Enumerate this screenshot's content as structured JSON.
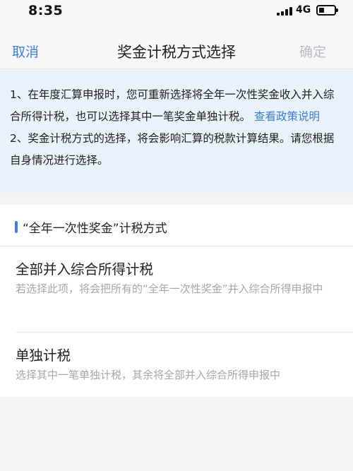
{
  "status_bar": {
    "time": "8:35",
    "network": "4G",
    "icons": [
      "signal-bars-icon",
      "battery-icon"
    ]
  },
  "nav": {
    "cancel_label": "取消",
    "title": "奖金计税方式选择",
    "confirm_label": "确定"
  },
  "notice": {
    "line1_text": "1、在年度汇算申报时，您可重新选择将全年一次性奖金收入并入综合所得计税，也可以选择其中一笔奖金单独计税。",
    "line1_link": "查看政策说明",
    "line2_text": "2、奖金计税方式的选择，将会影响汇算的税款计算结果。请您根据自身情况进行选择。"
  },
  "section": {
    "title": "“全年一次性奖金”计税方式",
    "options": [
      {
        "title": "全部并入综合所得计税",
        "description": "若选择此项，将会把所有的“全年一次性奖金”并入综合所得申报中"
      },
      {
        "title": "单独计税",
        "description": "选择其中一笔单独计税，其余将全部并入综合所得申报中"
      }
    ]
  },
  "colors": {
    "accent": "#3d7fe0",
    "notice_background": "#e9f1fb",
    "disabled_text": "#bcbcc2",
    "secondary_text": "#a6a6ac"
  }
}
